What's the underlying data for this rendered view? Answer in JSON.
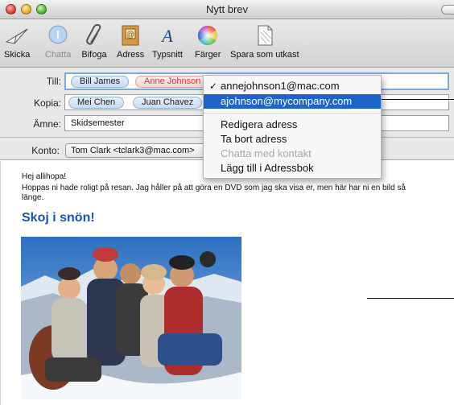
{
  "window": {
    "title": "Nytt brev"
  },
  "toolbar": {
    "send": "Skicka",
    "chat": "Chatta",
    "attach": "Bifoga",
    "address": "Adress",
    "fonts": "Typsnitt",
    "colors": "Färger",
    "save_draft": "Spara som utkast"
  },
  "fields": {
    "to_label": "Till:",
    "to_chips": [
      "Bill James",
      "Anne Johnson"
    ],
    "cc_label": "Kopia:",
    "cc_chips": [
      "Mei Chen",
      "Juan Chavez"
    ],
    "subject_label": "Ämne:",
    "subject_value": "Skidsemester",
    "account_label": "Konto:",
    "account_value": "Tom Clark <tclark3@mac.com>"
  },
  "address_menu": {
    "items": [
      {
        "label": "annejohnson1@mac.com",
        "checked": true
      },
      {
        "label": "ajohnson@mycompany.com",
        "selected": true
      },
      {
        "label": "Redigera adress"
      },
      {
        "label": "Ta bort adress"
      },
      {
        "label": "Chatta med kontakt",
        "disabled": true
      },
      {
        "label": "Lägg till i Adressbok"
      }
    ],
    "check_glyph": "✓"
  },
  "message": {
    "greeting": "Hej allihopa!",
    "paragraph": "Hoppas ni hade roligt på resan. Jag håller på att göra en DVD som jag ska visa er, men här har ni en bild så länge.",
    "heading": "Skoj i snön!",
    "heading_color": "#1a56b0"
  },
  "colors": {
    "menu_highlight": "#1e63c8",
    "focus_ring": "#7aa9dc"
  }
}
